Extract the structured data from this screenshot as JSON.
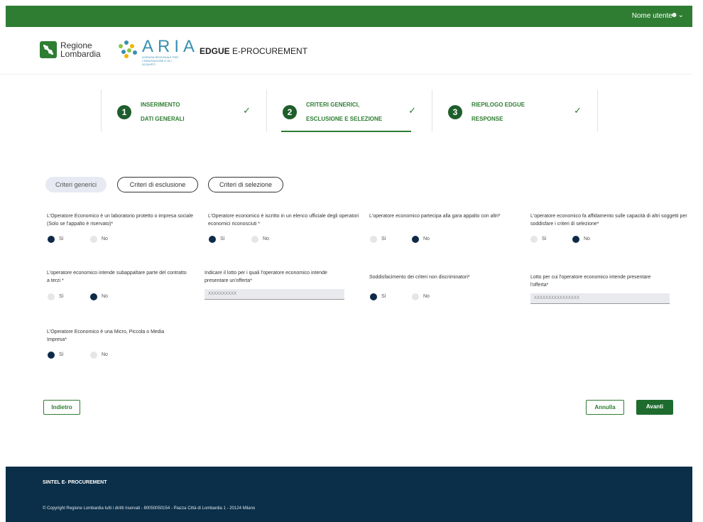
{
  "header": {
    "user_label": "Nome utente",
    "user_icon": "user-icon"
  },
  "brand": {
    "regione_lines": [
      "Regione",
      "Lombardia"
    ],
    "aria_word": "ARIA",
    "aria_sub": "AGENZIA REGIONALE PER L'INNOVAZIONE E GLI ACQUISTI",
    "app_title_bold": "EDGUE",
    "app_title_rest": "E-PROCUREMENT"
  },
  "stepper": [
    {
      "num": "1",
      "lines": [
        "INSERIMENTO",
        "DATI GENERALI"
      ],
      "done": true
    },
    {
      "num": "2",
      "lines": [
        "CRITERI GENERICI,",
        "ESCLUSIONE E SELEZIONE"
      ],
      "done": true,
      "active": true
    },
    {
      "num": "3",
      "lines": [
        "RIEPILOGO EDGUE",
        "RESPONSE"
      ],
      "done": true
    }
  ],
  "tabs": [
    "Criteri generici",
    "Criteri di esclusione",
    "Criteri di selezione"
  ],
  "questions": {
    "q1": {
      "label": "L'Operatore Economico è un laboratorio protetto o impresa sociale (Solo se l'appalto è riservato)*",
      "yes": "Sì",
      "no": "No",
      "selected": "yes"
    },
    "q2": {
      "label": "L'Operatore economico è iscritto in un elenco ufficiale degli operatori economici riconosciuti *",
      "yes": "Sì",
      "no": "No",
      "selected": "yes"
    },
    "q3": {
      "label": "L'operatore economico partecipa alla gara appalto con altri*",
      "yes": "Sì",
      "no": "No",
      "selected": "no"
    },
    "q4": {
      "label": "L'operatore economico fa affidamento sulle capacità di altri soggetti per soddisfare i criteri di selezione*",
      "yes": "Sì",
      "no": "No",
      "selected": "no"
    },
    "q5": {
      "label": "L'operatore economico intende subappaltare parte del contratto a terzi *",
      "yes": "Sì",
      "no": "No",
      "selected": "no"
    },
    "q6": {
      "label": "Indicare il lotto per i quali l'operatore economico intende presentare un'offerta*",
      "value": "XXXXXXXXXX"
    },
    "q7": {
      "label": "Soddisfacimento dei criteri non discriminatori*",
      "yes": "Sì",
      "no": "No",
      "selected": "yes"
    },
    "q8": {
      "label": "Lotto per cui l'operatore economico intende presentare l'offerta*",
      "value": "XXXXXXXXXXXXXXXX"
    },
    "q9": {
      "label": "L'Operatore Economico è una Micro, Piccola o Media Impresa*",
      "yes": "Sì",
      "no": "No",
      "selected": "yes"
    }
  },
  "actions": {
    "back": "Indietro",
    "cancel": "Annulla",
    "next": "Avanti"
  },
  "footer": {
    "title": "SINTEL E- PROCUREMENT",
    "copyright": "© Copyright Regione Lombardia tutti i diritti riservati - 80050050154 - Piazza Città di Lombardia 1 - 20124 Milano"
  },
  "colors": {
    "primary_green": "#2e7d32",
    "dark_navy": "#0b2f48",
    "radio_on": "#0e2a47"
  }
}
